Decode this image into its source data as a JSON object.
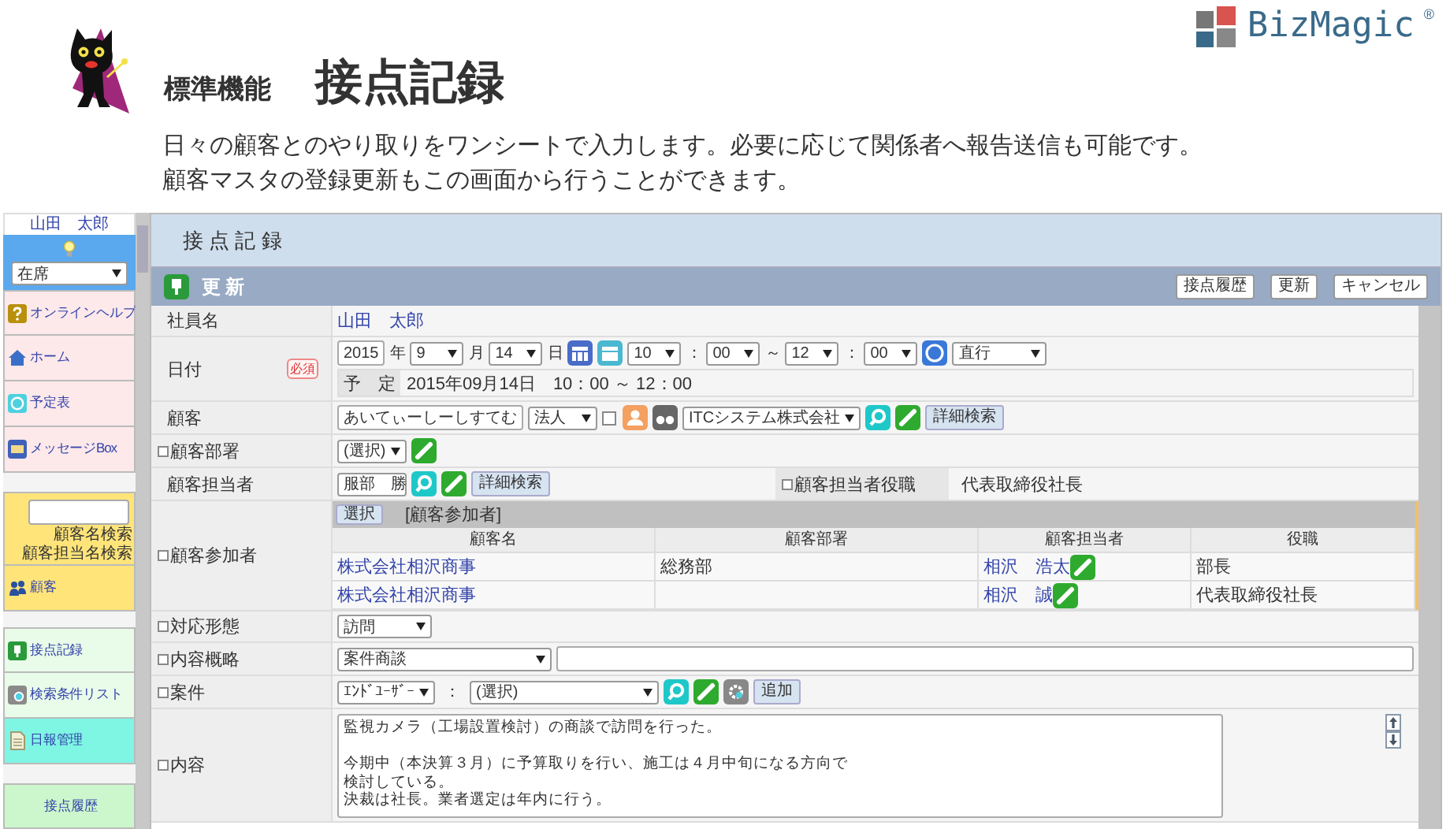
{
  "header": {
    "feature": "標準機能",
    "title": "接点記録",
    "description": [
      "日々の顧客とのやり取りをワンシートで入力します。必要に応じて関係者へ報告送信も可能です。",
      "顧客マスタの登録更新もこの画面から行うことができます。"
    ],
    "brand": "BizMagic",
    "brand_mark": "®"
  },
  "sidebar": {
    "user": "山田　太郎",
    "status": "在席",
    "groups": [
      {
        "kind": "menu",
        "color": "#fde8ea",
        "items": [
          {
            "label": "オンラインヘルプ",
            "selected": false
          },
          {
            "label": "ホーム",
            "selected": false
          },
          {
            "label": "予定表",
            "selected": false
          },
          {
            "label": "メッセージBox",
            "selected": false
          }
        ]
      },
      {
        "kind": "search",
        "color": "#ffe47a",
        "links": [
          "顧客名検索",
          "顧客担当名検索"
        ],
        "items": [
          {
            "label": "顧客",
            "selected": false
          }
        ]
      },
      {
        "kind": "menu",
        "color": "#e9fbe9",
        "items": [
          {
            "label": "接点記録",
            "selected": false
          },
          {
            "label": "検索条件リスト",
            "selected": false
          },
          {
            "label": "日報管理",
            "selected": true
          }
        ]
      },
      {
        "kind": "menu",
        "color": "#ccf7cc",
        "items": [
          {
            "label": "接点履歴",
            "selected": false
          }
        ]
      }
    ]
  },
  "panel": {
    "title": "接 点 記 録",
    "section": "更新",
    "actions": [
      "接点履歴",
      "更新",
      "キャンセル"
    ],
    "rows": [
      {
        "kind": "text",
        "label": "社員名",
        "toggle": false,
        "value": "山田　太郎"
      },
      {
        "kind": "date",
        "label": "日付",
        "toggle": false,
        "required": "必須",
        "year": "2015",
        "year_unit": "年",
        "month": "9",
        "month_unit": "月",
        "day": "14",
        "day_unit": "日",
        "times": [
          {
            "hour": "10",
            "separator": "：",
            "minute": "00"
          },
          {
            "hour": "12",
            "separator": "：",
            "minute": "00"
          }
        ],
        "range_mark": "～",
        "mode": "直行",
        "plan_label": "予　定",
        "plan": "2015年09月14日　10：00 ～ 12：00"
      },
      {
        "kind": "customer",
        "label": "顧客",
        "toggle": false,
        "name": "あいてぃーしーしすてむ",
        "type": "法人",
        "checked": false,
        "company": "ITCシステム株式会社",
        "button": "詳細検索"
      },
      {
        "kind": "department",
        "label": "顧客部署",
        "toggle": true,
        "value": "(選択)"
      },
      {
        "kind": "contact",
        "label": "顧客担当者",
        "toggle": false,
        "value": "服部　勝",
        "button": "詳細検索",
        "side_label": "顧客担当者役職",
        "side_toggle": true,
        "side_value": "代表取締役社長"
      },
      {
        "kind": "participants",
        "label": "顧客参加者",
        "toggle": true,
        "button": "選択",
        "caption": "[顧客参加者]",
        "columns": [
          "顧客名",
          "顧客部署",
          "顧客担当者",
          "役職"
        ],
        "rows": [
          {
            "company": "株式会社相沢商事",
            "department": "総務部",
            "contact": "相沢　浩太",
            "position": "部長"
          },
          {
            "company": "株式会社相沢商事",
            "contact": "相沢　誠",
            "position": "代表取締役社長"
          }
        ]
      },
      {
        "kind": "select",
        "label": "対応形態",
        "toggle": true,
        "value": "訪問"
      },
      {
        "kind": "summary",
        "label": "内容概略",
        "toggle": true,
        "value": "案件商談"
      },
      {
        "kind": "project",
        "label": "案件",
        "toggle": true,
        "type": "ｴﾝﾄﾞﾕｰｻﾞｰ",
        "separator": "：",
        "value": "(選択)",
        "button": "追加"
      },
      {
        "kind": "content",
        "label": "内容",
        "toggle": true,
        "paragraphs": [
          [
            "監視カメラ（工場設置検討）の商談で訪問を行った。"
          ],
          [
            "今期中（本決算３月）に予算取りを行い、施工は４月中旬になる方向で",
            "検討している。",
            "決裁は社長。業者選定は年内に行う。"
          ]
        ]
      }
    ]
  }
}
